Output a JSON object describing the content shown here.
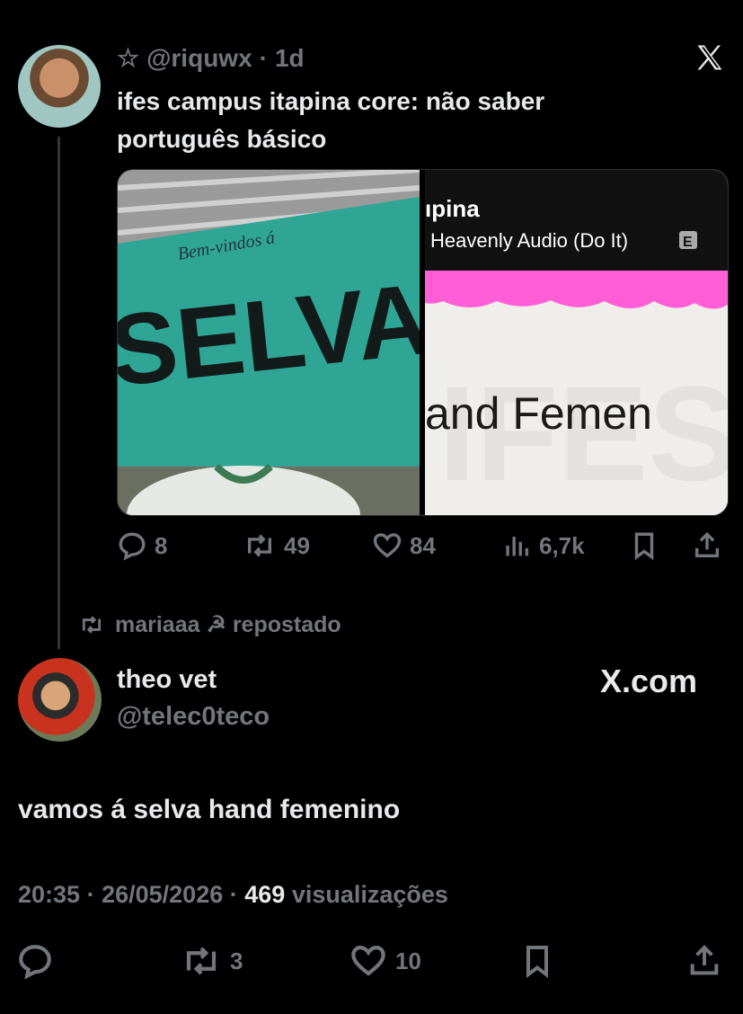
{
  "quoted": {
    "star": "☆",
    "handle": "@riquwx",
    "sep": "·",
    "age": "1d",
    "text": "ifes campus itapina core: não saber português básico",
    "media_left": {
      "banner_small": "Bem-vindos á",
      "banner_big": "SELVA"
    },
    "media_right": {
      "title_partial": "ıpina",
      "subtitle": "Heavenly Audio (Do It)",
      "explicit_badge": "E",
      "bg_word": "IFES",
      "fg_text": "and Femen"
    },
    "stats": {
      "replies": "8",
      "reposts": "49",
      "likes": "84",
      "views": "6,7k"
    }
  },
  "repost_banner": {
    "text": "mariaaa ☭ repostado"
  },
  "post": {
    "author_name": "theo vet",
    "author_handle": "@telec0teco",
    "brand": "X.com",
    "text": "vamos á selva hand femenino",
    "time": "20:35",
    "dot1": "·",
    "date": "26/05/2026",
    "dot2": "·",
    "views_count": "469",
    "views_label": "visualizações",
    "stats": {
      "reposts": "3",
      "likes": "10"
    }
  },
  "colors": {
    "bg": "#000000",
    "text": "#e7e9ea",
    "muted": "#71767b",
    "teal": "#2fa596",
    "pink": "#ff5ed6"
  }
}
